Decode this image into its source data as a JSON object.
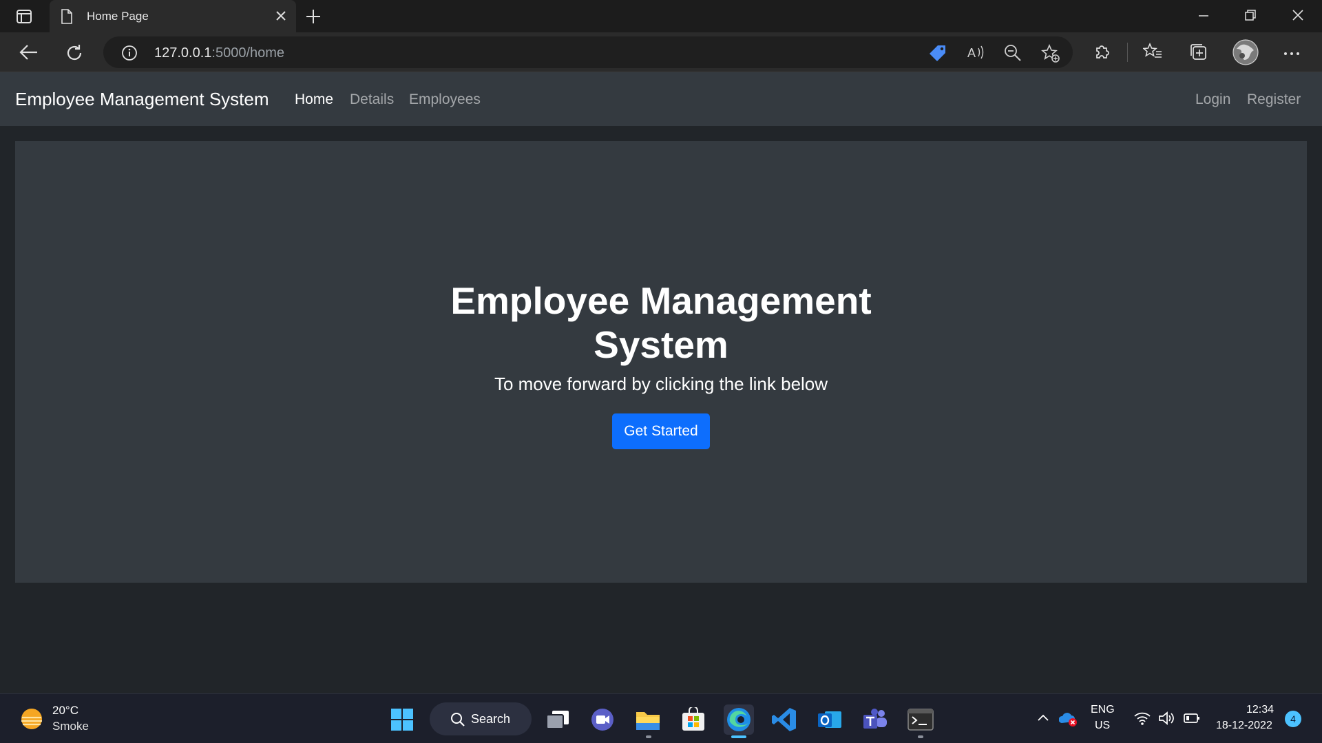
{
  "browser": {
    "tab": {
      "title": "Home Page"
    },
    "url": {
      "host": "127.0.0.1",
      "path": ":5000/home"
    }
  },
  "site": {
    "brand": "Employee Management System",
    "nav": {
      "home": "Home",
      "details": "Details",
      "employees": "Employees",
      "login": "Login",
      "register": "Register"
    },
    "hero": {
      "title_line1": "Employee Management",
      "title_line2": "System",
      "subtitle": "To move forward by clicking the link below",
      "button": "Get Started"
    },
    "colors": {
      "navbar": "#343a40",
      "page_bg": "#212529",
      "primary": "#0d6efd"
    }
  },
  "taskbar": {
    "weather": {
      "temp": "20°C",
      "desc": "Smoke"
    },
    "search_label": "Search",
    "lang": {
      "line1": "ENG",
      "line2": "US"
    },
    "clock": {
      "time": "12:34",
      "date": "18-12-2022"
    },
    "notification_count": "4",
    "apps": [
      "start-icon",
      "search",
      "task-view-icon",
      "meet-icon",
      "file-explorer-icon",
      "store-icon",
      "edge-icon",
      "vscode-icon",
      "outlook-icon",
      "teams-icon",
      "terminal-icon"
    ]
  }
}
